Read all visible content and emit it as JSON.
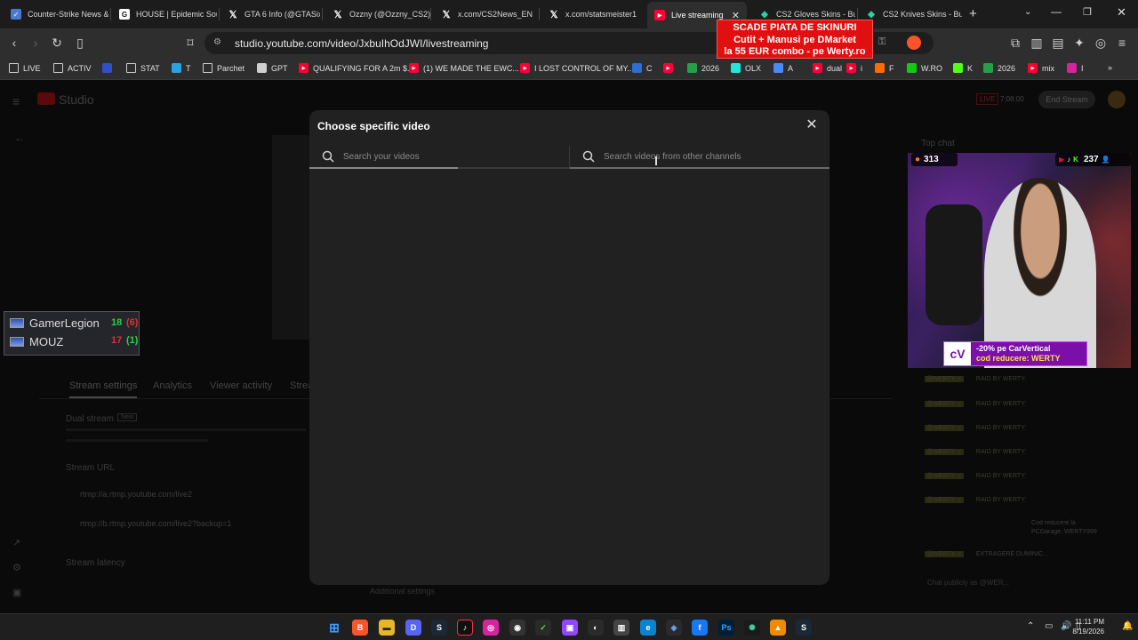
{
  "browser": {
    "tabs": [
      {
        "title": "Counter-Strike News &",
        "icon": "cs-news-icon",
        "color": "#4a7bd0"
      },
      {
        "title": "HOUSE | Epidemic Sou",
        "icon": "epidemic-sound-icon",
        "color": "#ffffff"
      },
      {
        "title": "GTA 6 Info (@GTASixI",
        "icon": "x-icon",
        "color": "#ffffff"
      },
      {
        "title": "Ozzny (@Ozzny_CS2)",
        "icon": "x-icon",
        "color": "#ffffff"
      },
      {
        "title": "x.com/CS2News_EN",
        "icon": "x-icon",
        "color": "#ffffff"
      },
      {
        "title": "x.com/statsmeister1",
        "icon": "x-icon",
        "color": "#ffffff"
      },
      {
        "title": "Live streaming",
        "icon": "youtube-icon",
        "color": "#ff0033"
      },
      {
        "title": "CS2 Gloves Skins - Bu",
        "icon": "skins-icon",
        "color": "#2bd1a0"
      },
      {
        "title": "CS2 Knives Skins - Bu",
        "icon": "skins-icon",
        "color": "#2bd1a0"
      }
    ],
    "url": "studio.youtube.com/video/JxbuIhOdJWI/livestreaming",
    "bookmarks": [
      {
        "label": "LIVE",
        "icon": "folder-icon",
        "color": "#cccccc"
      },
      {
        "label": "ACTIV",
        "icon": "folder-icon",
        "color": "#cccccc"
      },
      {
        "label": "",
        "icon": "blue-app-icon",
        "color": "#3050c8"
      },
      {
        "label": "STAT",
        "icon": "folder-icon",
        "color": "#cccccc"
      },
      {
        "label": "T",
        "icon": "telegram-icon",
        "color": "#2aa3e0"
      },
      {
        "label": "Parchet",
        "icon": "folder-icon",
        "color": "#cccccc"
      },
      {
        "label": "GPT",
        "icon": "chatgpt-icon",
        "color": "#cfcfcf"
      },
      {
        "label": "QUALIFYING FOR A 2m $...",
        "icon": "youtube-icon",
        "color": "#ff0033"
      },
      {
        "label": "(1) WE MADE THE EWC...",
        "icon": "youtube-icon",
        "color": "#ff0033"
      },
      {
        "label": "I LOST CONTROL OF MY...",
        "icon": "youtube-icon",
        "color": "#ff0033"
      },
      {
        "label": "C",
        "icon": "calendar-icon",
        "color": "#2a6fd6"
      },
      {
        "label": "",
        "icon": "youtube-icon",
        "color": "#ff0033"
      },
      {
        "label": "2026",
        "icon": "green-app-icon",
        "color": "#24a148"
      },
      {
        "label": "OLX",
        "icon": "olx-icon",
        "color": "#23e5db"
      },
      {
        "label": "A",
        "icon": "docs-icon",
        "color": "#4a8af4"
      },
      {
        "label": "dual",
        "icon": "youtube-icon",
        "color": "#ff0033"
      },
      {
        "label": "i",
        "icon": "youtube-icon",
        "color": "#ff0033"
      },
      {
        "label": "F",
        "icon": "orange-app-icon",
        "color": "#ff6a00"
      },
      {
        "label": "W.RO",
        "icon": "werty-icon",
        "color": "#14c914"
      },
      {
        "label": "K",
        "icon": "kick-icon",
        "color": "#53fc18"
      },
      {
        "label": "2026",
        "icon": "green-app-icon",
        "color": "#24a148"
      },
      {
        "label": "mix",
        "icon": "youtube-icon",
        "color": "#ff0033"
      },
      {
        "label": "I",
        "icon": "instagram-icon",
        "color": "#d6249f"
      }
    ]
  },
  "promo": {
    "line1": "SCADE PIATA DE SKINURI",
    "line2": "Cutit + Manusi pe DMarket",
    "line3": "la 55 EUR combo - pe Werty.ro"
  },
  "studio_background": {
    "brand": "Studio",
    "live_badge": "LIVE",
    "live_time": "7:08:00",
    "end_stream": "End Stream",
    "chat_header": "Top chat",
    "tabs": [
      "Stream settings",
      "Analytics",
      "Viewer activity",
      "Strea"
    ],
    "dual_stream": "Dual stream",
    "dual_badge": "New",
    "stream_url_label": "Stream URL",
    "stream_url": "rtmp://a.rtmp.youtube.com/live2",
    "backup_url": "rtmp://b.rtmp.youtube.com/live2?backup=1",
    "stream_latency": "Stream latency",
    "additional_settings": "Additional settings",
    "chat_placeholder": "Chat publicly as @WER...",
    "raid_text": "RAID BY WERTY:",
    "promo_chat": "Cod reducere la PCGarage: WERTY999",
    "extract_chat": "EXTRAGERE DUMINIC..."
  },
  "scoreboard": {
    "teams": [
      {
        "name": "GamerLegion",
        "score": "18",
        "sub": "(6)",
        "score_color": "#27d045",
        "sub_color": "#e03030"
      },
      {
        "name": "MOUZ",
        "score": "17",
        "sub": "(1)",
        "score_color": "#e03030",
        "sub_color": "#27d045"
      }
    ]
  },
  "webcam": {
    "viewers_left": "313",
    "viewers_right": "237",
    "cv_promo_line1": "-20% pe CarVertical",
    "cv_promo_line2": "cod reducere: WERTY"
  },
  "modal": {
    "title": "Choose specific video",
    "search_own_placeholder": "Search your videos",
    "search_other_placeholder": "Search videos from other channels"
  },
  "taskbar": {
    "time": "11:11 PM",
    "date": "8/19/2026"
  }
}
